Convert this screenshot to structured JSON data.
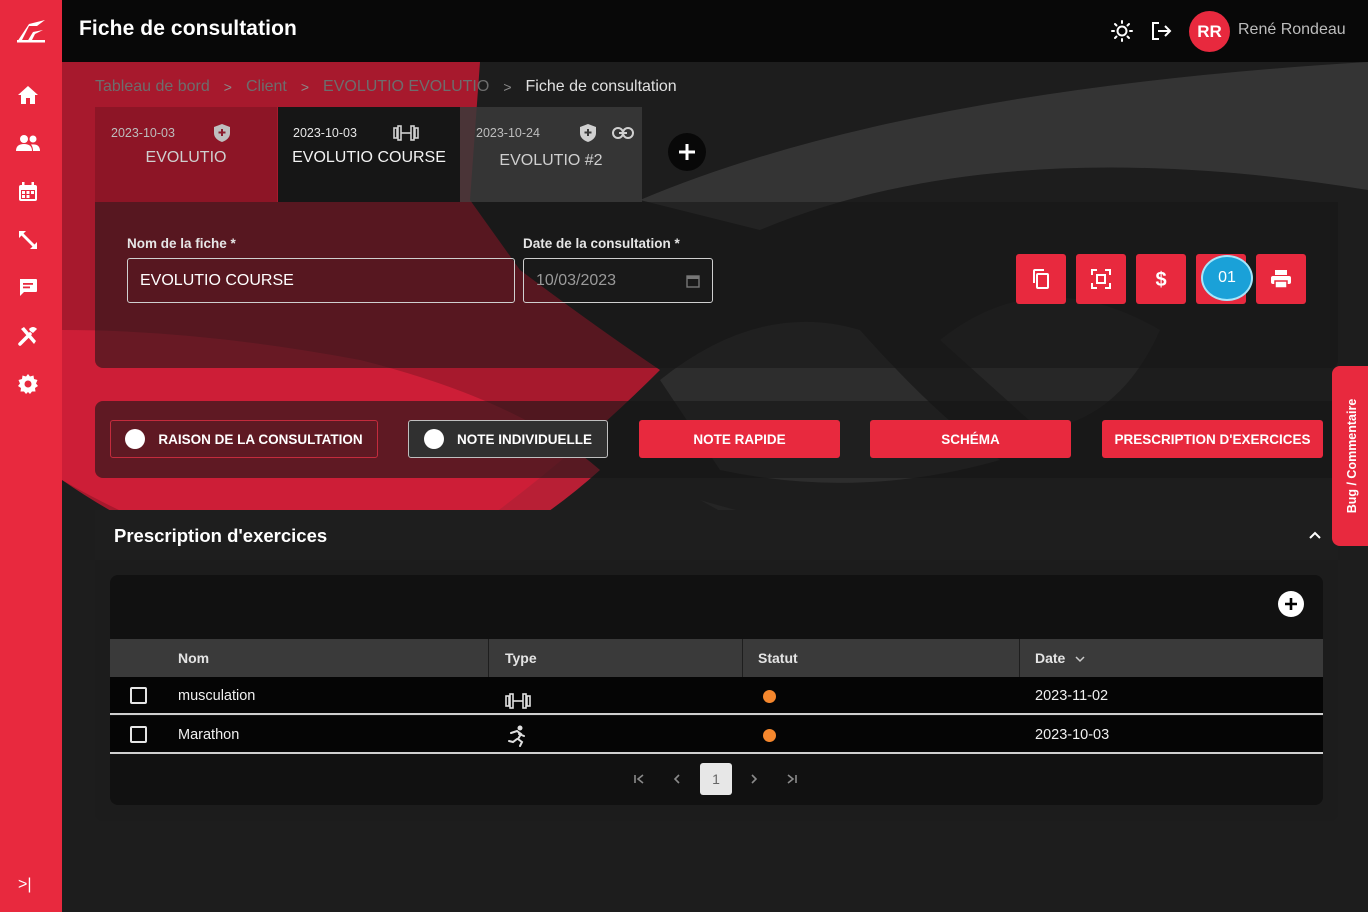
{
  "app": {
    "title": "Fiche de consultation",
    "user": {
      "initials": "RR",
      "name": "René Rondeau"
    },
    "icons": [
      "brightness-icon",
      "logout-icon"
    ]
  },
  "colors": {
    "accent": "#e8293e",
    "topbar": "#080808",
    "status_pending": "#f5872d",
    "badge": "#1aa1d8"
  },
  "sidebar": {
    "items": [
      {
        "icon": "home-icon"
      },
      {
        "icon": "users-icon"
      },
      {
        "icon": "calendar-icon"
      },
      {
        "icon": "resize-icon"
      },
      {
        "icon": "chat-icon"
      },
      {
        "icon": "tools-icon"
      },
      {
        "icon": "gear-icon"
      }
    ],
    "collapse_label": ">|"
  },
  "breadcrumb": {
    "items": [
      "Tableau de bord",
      "Client",
      "EVOLUTIO EVOLUTIO",
      "Fiche de consultation"
    ],
    "separator": ">"
  },
  "tabs": [
    {
      "date": "2023-10-03",
      "name": "EVOLUTIO",
      "icon": "shield-icon"
    },
    {
      "date": "2023-10-03",
      "name": "EVOLUTIO COURSE",
      "icon": "dumbbell-icon"
    },
    {
      "date": "2023-10-24",
      "name": "EVOLUTIO #2",
      "icon": "shield-icon",
      "icon2": "link-icon"
    }
  ],
  "form": {
    "name_label": "Nom de la fiche *",
    "name_value": "EVOLUTIO COURSE",
    "date_label": "Date de la consultation *",
    "date_value": "10/03/2023",
    "actions": [
      "copy-icon",
      "scan-icon",
      "dollar-icon",
      "print-icon"
    ],
    "badge": "01"
  },
  "toggles": [
    {
      "label": "RAISON DE LA CONSULTATION",
      "style": "outline"
    },
    {
      "label": "NOTE INDIVIDUELLE",
      "style": "outline-selected"
    },
    {
      "label": "NOTE RAPIDE",
      "style": "filled"
    },
    {
      "label": "SCHÉMA",
      "style": "filled"
    },
    {
      "label": "PRESCRIPTION D'EXERCICES",
      "style": "filled"
    }
  ],
  "prescription": {
    "title": "Prescription d'exercices",
    "columns": [
      "Nom",
      "Type",
      "Statut",
      "Date"
    ],
    "rows": [
      {
        "nom": "musculation",
        "type": "dumbbell-icon",
        "date": "2023-11-02"
      },
      {
        "nom": "Marathon",
        "type": "runner-icon",
        "date": "2023-10-03"
      }
    ],
    "pager": {
      "current": "1"
    }
  },
  "bug_tab": "Bug / Commentaire"
}
